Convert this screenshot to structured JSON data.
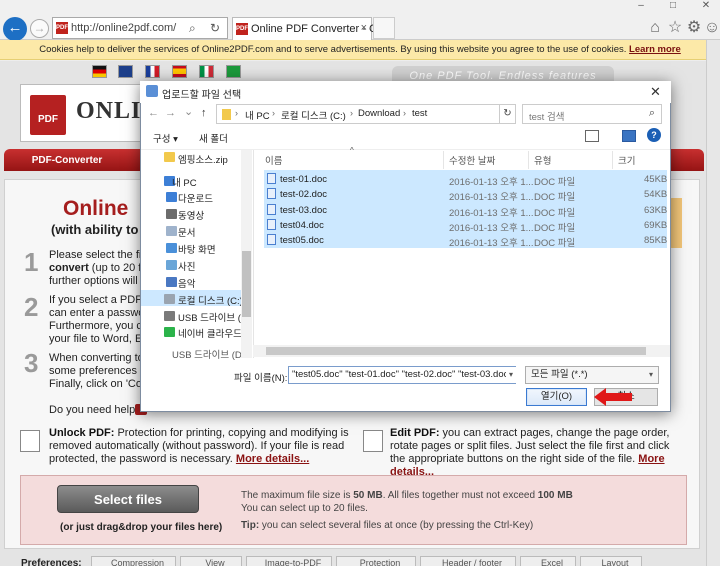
{
  "browser": {
    "url": "http://online2pdf.com/",
    "tab_title": "Online PDF Converter - Cr...",
    "favicon_text": "PDF",
    "back_icon": "←",
    "fwd_icon": "→",
    "search_icon": "⌕",
    "refresh_icon": "↻",
    "close_tab": "×",
    "home_icon": "⌂",
    "star_icon": "☆",
    "gear_icon": "⚙",
    "smiley_icon": "☺",
    "win_min": "–",
    "win_max": "□",
    "win_close": "✕"
  },
  "cookie": {
    "text": "Cookies help to deliver the services of Online2PDF.com and to serve advertisements. By using this website you agree to the use of cookies.",
    "link": "Learn more"
  },
  "site": {
    "tagline": "One PDF Tool. Endless features",
    "logo_box": "PDF",
    "logo_text": "ONLI",
    "menu_pdf": "PDF-Converter",
    "title": "Online",
    "subtitle": "(with ability to c",
    "step1_num": "1",
    "step1_l1": "Please select the file",
    "step1_l2": "convert",
    "step1_l2b": " (up to 20 file",
    "step1_l3": "further options will be",
    "step2_num": "2",
    "step2_l1": "If you select a PDF fi",
    "step2_l2": "can enter a passwor",
    "step2_l3": "Furthermore, you ca",
    "step2_l4": "your file to Word, Ex",
    "step3_num": "3",
    "step3_l1": "When converting to P",
    "step3_l2": "some preferences re",
    "step3_l3": "Finally, click on 'Conv",
    "help": "Do you need help?",
    "unlock_title": "Unlock PDF:",
    "unlock_text": " Protection for printing, copying and modifying is removed automatically (without password). If your file is read protected, the password is necessary.",
    "edit_title": "Edit PDF:",
    "edit_text": " you can extract pages, change the page order, rotate pages or split files. Just select the file first and click the appropriate buttons on the right side of the file.",
    "more_details": "More details...",
    "select_files": "Select files",
    "drag_note": "(or just drag&drop your files here)",
    "max_l1a": "The maximum file size is ",
    "max_size": "50 MB",
    "max_l1b": ". All files together must not exceed ",
    "max_total": "100 MB",
    "max_l2": "You can select up to 20 files.",
    "tip_label": "Tip:",
    "tip_text": " you can select several files at once (by pressing the Ctrl-Key)",
    "pref_label": "Preferences:",
    "prefs": [
      "Compression",
      "View",
      "Image-to-PDF",
      "Protection",
      "Header / footer",
      "Excel",
      "Layout"
    ]
  },
  "dialog": {
    "title": "업로드할 파일 선택",
    "close": "✕",
    "nav_back": "←",
    "nav_fwd": "→",
    "nav_down": "⌄",
    "nav_up": "↑",
    "crumbs": [
      "내 PC",
      "로컬 디스크 (C:)",
      "Download",
      "test"
    ],
    "crumb_sep": "›",
    "refresh": "↻",
    "search_placeholder": "test 검색",
    "search_icon": "⌕",
    "organize": "구성 ▾",
    "new_folder": "새 폴더",
    "help": "?",
    "tree": [
      "엠핑소스.zip",
      "내 PC",
      "다운로드",
      "동영상",
      "문서",
      "바탕 화면",
      "사진",
      "음악",
      "로컬 디스크 (C:)",
      "USB 드라이브 (D",
      "네이버 클라우드",
      "USB 드라이브 (D:"
    ],
    "columns": [
      "이름",
      "수정한 날짜",
      "유형",
      "크기"
    ],
    "files": [
      {
        "name": "test-01.doc",
        "date": "2016-01-13 오후 1...",
        "type": "DOC 파일",
        "size": "45KB"
      },
      {
        "name": "test-02.doc",
        "date": "2016-01-13 오후 1...",
        "type": "DOC 파일",
        "size": "54KB"
      },
      {
        "name": "test-03.doc",
        "date": "2016-01-13 오후 1...",
        "type": "DOC 파일",
        "size": "63KB"
      },
      {
        "name": "test04.doc",
        "date": "2016-01-13 오후 1...",
        "type": "DOC 파일",
        "size": "69KB"
      },
      {
        "name": "test05.doc",
        "date": "2016-01-13 오후 1...",
        "type": "DOC 파일",
        "size": "85KB"
      }
    ],
    "filename_label": "파일 이름(N):",
    "filename_value": "\"test05.doc\" \"test-01.doc\" \"test-02.doc\" \"test-03.doc\" \"te",
    "filetype_value": "모든 파일 (*.*)",
    "open_btn": "열기(O)",
    "cancel_btn": "취소"
  },
  "colors": {
    "brand_red": "#a51e1e",
    "selection": "#cce8ff",
    "accent_blue": "#1d6fc4",
    "annotation_arrow": "#e01818"
  }
}
